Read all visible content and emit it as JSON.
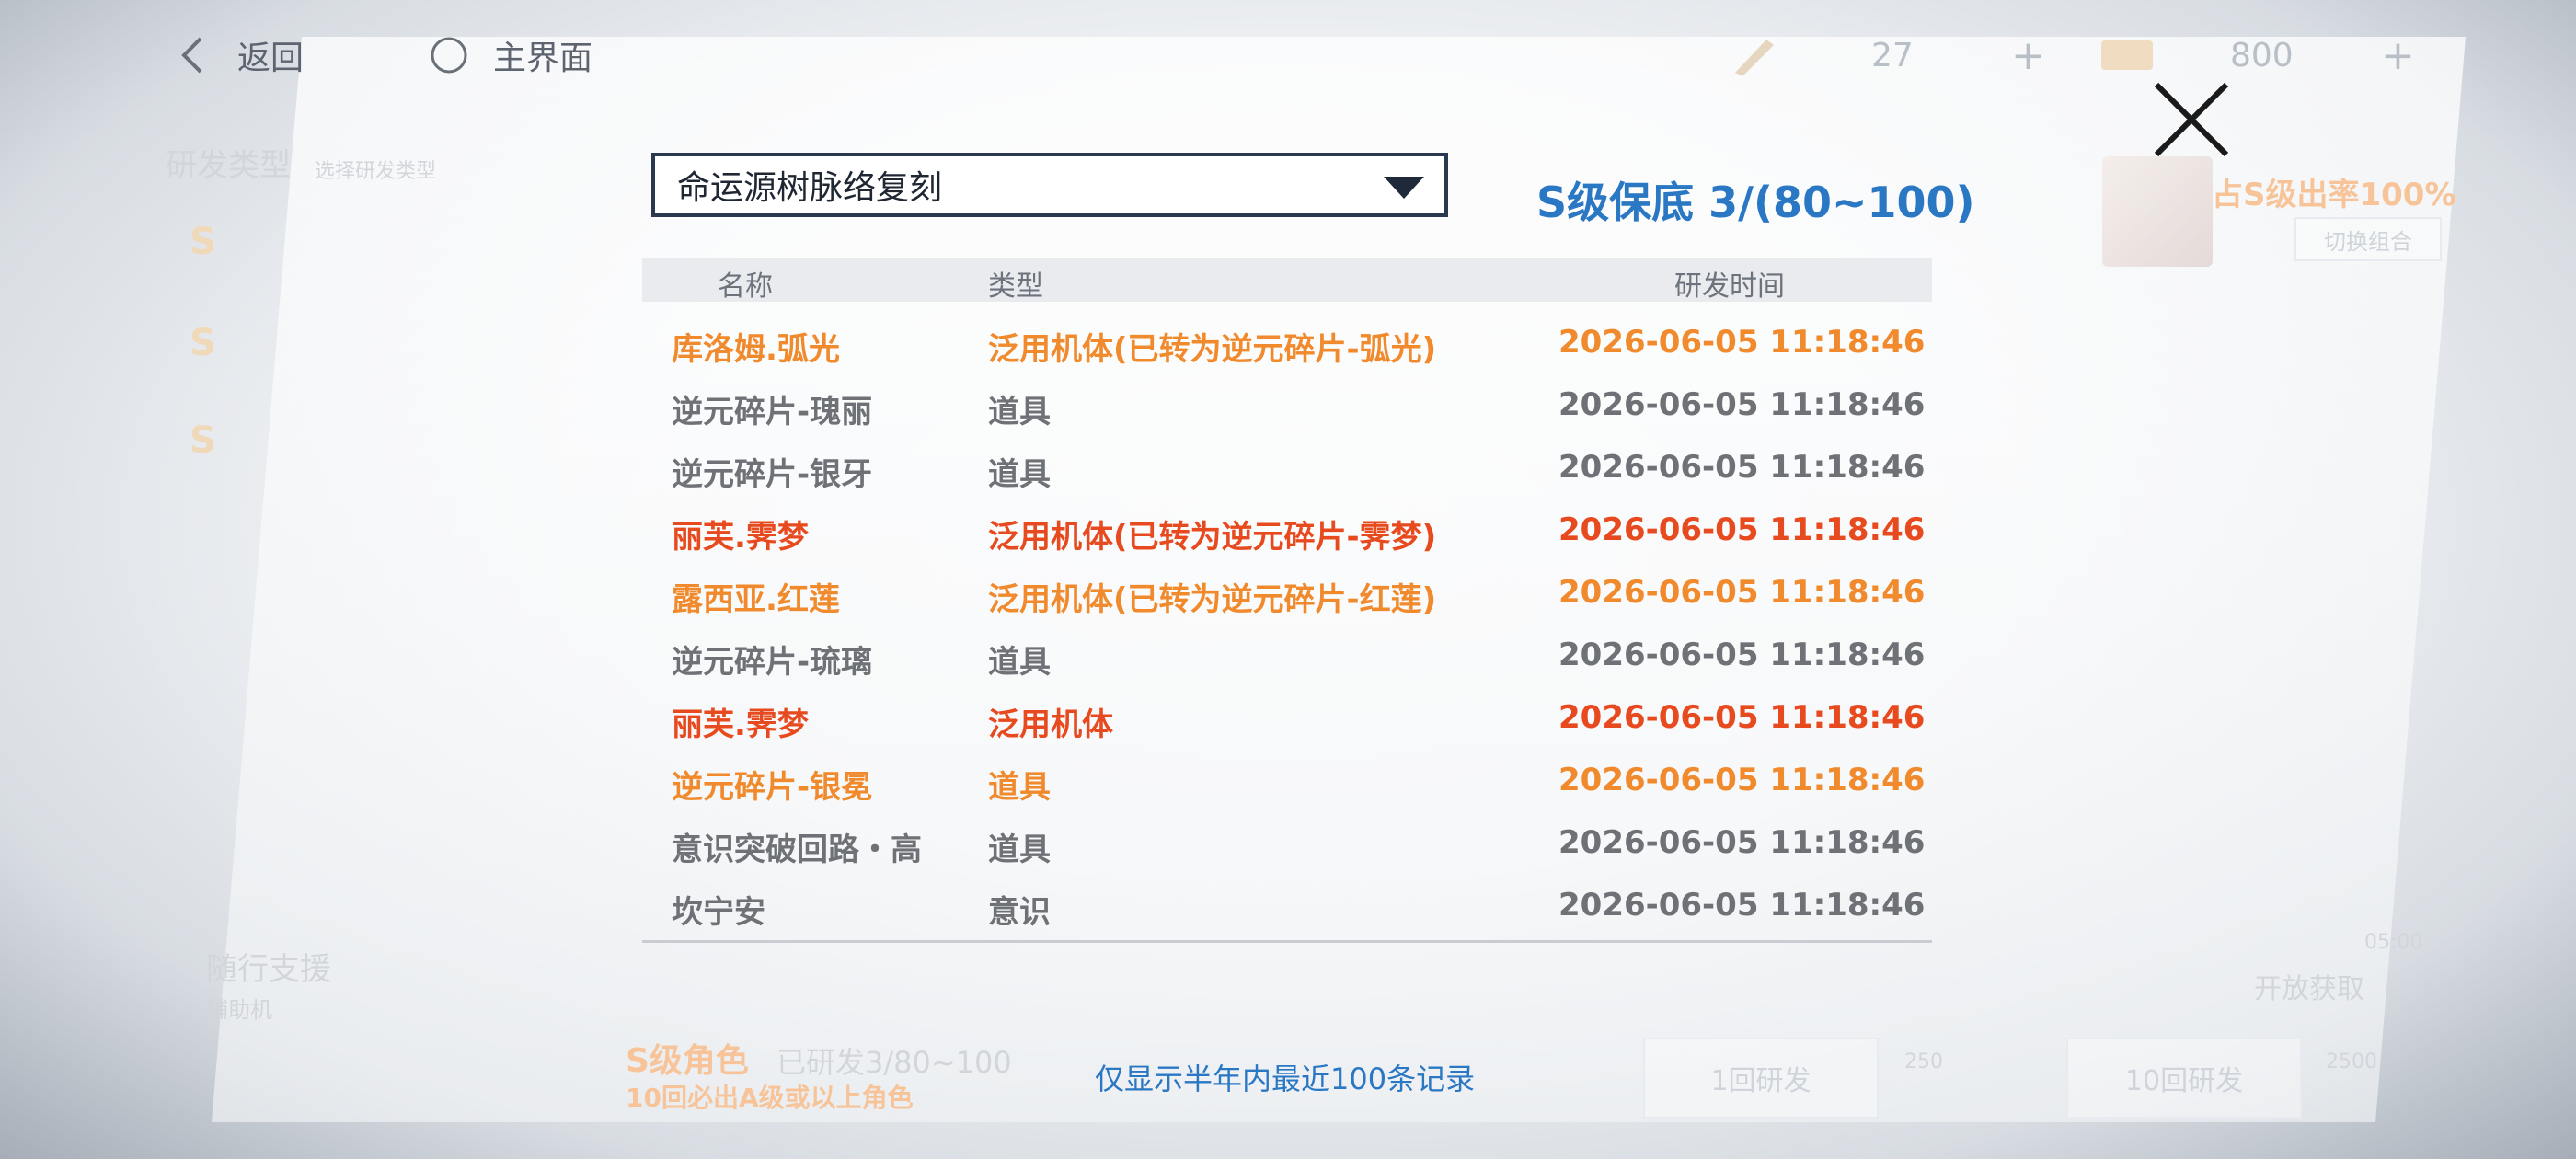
{
  "topbar": {
    "back_label": "返回",
    "home_label": "主界面",
    "currency1_value": "27",
    "currency2_value": "800",
    "plus": "+"
  },
  "background": {
    "section_title": "研发类型",
    "section_sub": "选择研发类型",
    "s_letter": "S",
    "rate_text": "占S级出率100%",
    "switch_label": "切换组合",
    "assist_title": "随行支援",
    "assist_sub": "辅助机",
    "s_role": "S级角色",
    "researched": "已研发3/80~100",
    "guarantee": "10回必出A级或以上角色",
    "open_text": "开放获取",
    "btn1": "1回研发",
    "btn1_cost": "250",
    "btn10": "10回研发",
    "btn10_cost": "2500",
    "time_small": "05:00"
  },
  "modal": {
    "pool_select": "命运源树脉络复刻",
    "pity": "S级保底 3/(80~100)",
    "headers": {
      "name": "名称",
      "type": "类型",
      "time": "研发时间"
    },
    "rows": [
      {
        "name": "库洛姆.弧光",
        "type": "泛用机体(已转为逆元碎片-弧光)",
        "time": "2026-06-05 11:18:46",
        "color": "orange"
      },
      {
        "name": "逆元碎片-瑰丽",
        "type": "道具",
        "time": "2026-06-05 11:18:46",
        "color": "gray"
      },
      {
        "name": "逆元碎片-银牙",
        "type": "道具",
        "time": "2026-06-05 11:18:46",
        "color": "gray"
      },
      {
        "name": "丽芙.霁梦",
        "type": "泛用机体(已转为逆元碎片-霁梦)",
        "time": "2026-06-05 11:18:46",
        "color": "red"
      },
      {
        "name": "露西亚.红莲",
        "type": "泛用机体(已转为逆元碎片-红莲)",
        "time": "2026-06-05 11:18:46",
        "color": "orange"
      },
      {
        "name": "逆元碎片-琉璃",
        "type": "道具",
        "time": "2026-06-05 11:18:46",
        "color": "gray"
      },
      {
        "name": "丽芙.霁梦",
        "type": "泛用机体",
        "time": "2026-06-05 11:18:46",
        "color": "red"
      },
      {
        "name": "逆元碎片-银冕",
        "type": "道具",
        "time": "2026-06-05 11:18:46",
        "color": "orange"
      },
      {
        "name": "意识突破回路・高",
        "type": "道具",
        "time": "2026-06-05 11:18:46",
        "color": "gray"
      },
      {
        "name": "坎宁安",
        "type": "意识",
        "time": "2026-06-05 11:18:46",
        "color": "gray"
      }
    ],
    "footer_note": "仅显示半年内最近100条记录"
  },
  "colors": {
    "accent_blue": "#2a77c4",
    "orange": "#f08a2c",
    "red": "#e84a1f",
    "gray": "#6e7176"
  }
}
